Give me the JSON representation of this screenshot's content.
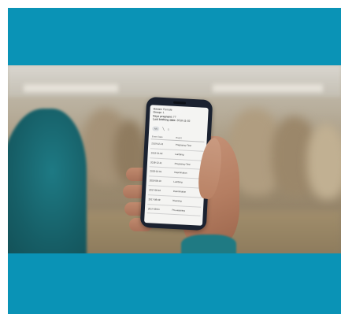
{
  "phone_screen": {
    "info": [
      {
        "label": "Owner:",
        "value": "Female"
      },
      {
        "label": "Group:",
        "value": "1"
      },
      {
        "label": "Days pregnant:",
        "value": "77"
      },
      {
        "label": "Last birthing date:",
        "value": "2018-11-02"
      }
    ],
    "chip_text": "AA",
    "icons": [
      "cow-icon",
      "syringe-icon",
      "home-icon"
    ],
    "table_headers": {
      "date": "Event Date",
      "event": "Event"
    },
    "rows": [
      {
        "date": "2019-02-13",
        "event": "Pregnancy Test"
      },
      {
        "date": "2019-01-02",
        "event": "Lambing"
      },
      {
        "date": "2018-12-11",
        "event": "Pregnancy Test"
      },
      {
        "date": "2018-10-01",
        "event": "Insemination"
      },
      {
        "date": "2018-08-10",
        "event": "Lambing"
      },
      {
        "date": "2017-08-10",
        "event": "Insemination"
      },
      {
        "date": "2017-08-09",
        "event": "Weaning"
      },
      {
        "date": "2017-08-01",
        "event": "Pre-weaning"
      }
    ]
  },
  "colors": {
    "band": "#0a93b6",
    "phone_body": "#1b2230",
    "screen_bg": "#f4f4f2",
    "shirt": "#1e7a84"
  }
}
